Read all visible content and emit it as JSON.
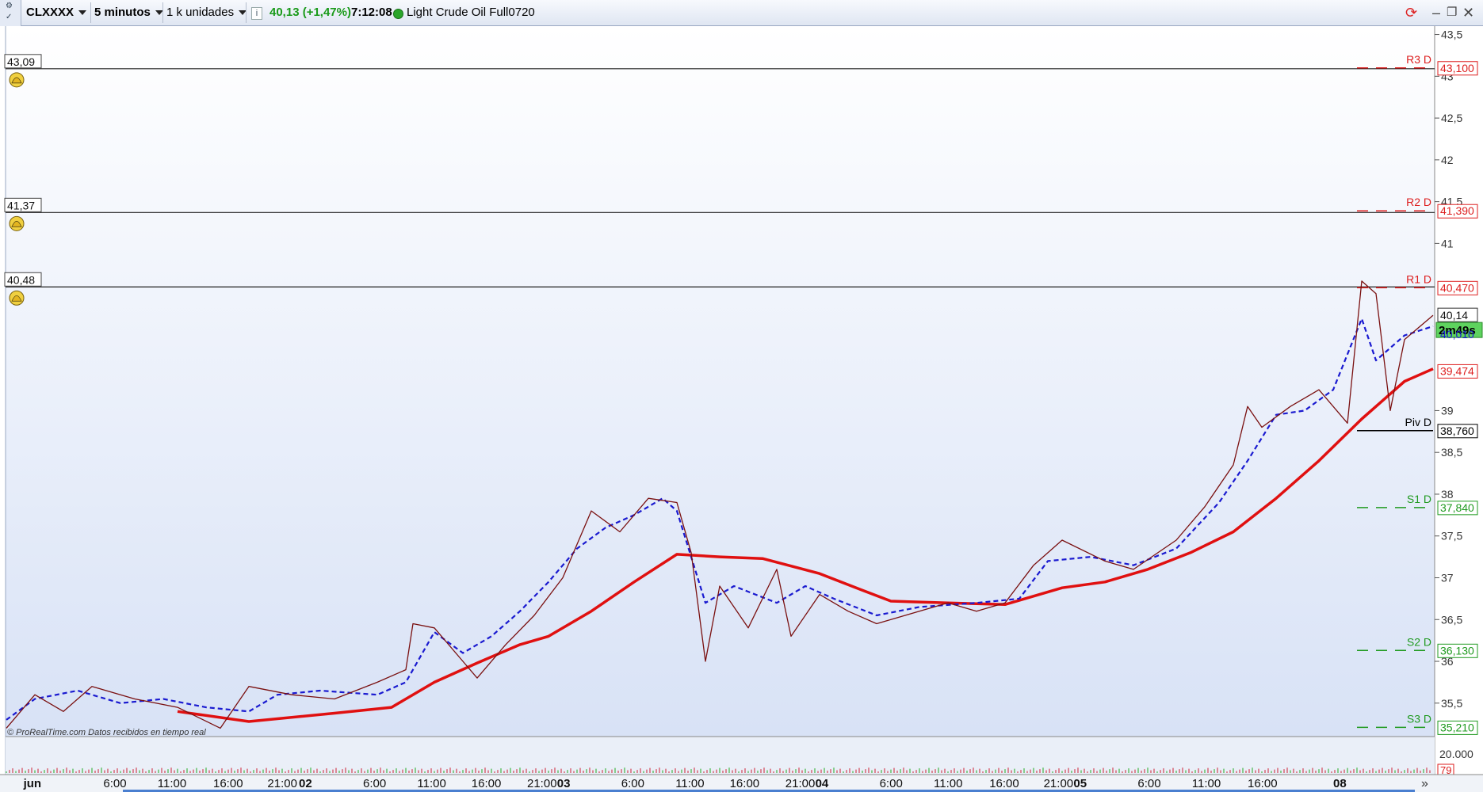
{
  "toolbar": {
    "symbol": "CLXXXX",
    "interval": "5 minutos",
    "units": "1 k unidades",
    "info_icon": "i",
    "price_change": "40,13 (+1,47%)",
    "time": "7:12:08",
    "instrument": "Light Crude Oil Full0720"
  },
  "price_axis": {
    "ticks": [
      {
        "v": 43.5,
        "label": "43,5"
      },
      {
        "v": 43,
        "label": "43"
      },
      {
        "v": 42.5,
        "label": "42,5"
      },
      {
        "v": 42,
        "label": "42"
      },
      {
        "v": 41.5,
        "label": "41,5"
      },
      {
        "v": 41,
        "label": "41"
      },
      {
        "v": 39,
        "label": "39"
      },
      {
        "v": 38.5,
        "label": "38,5"
      },
      {
        "v": 38,
        "label": "38"
      },
      {
        "v": 37.5,
        "label": "37,5"
      },
      {
        "v": 37,
        "label": "37"
      },
      {
        "v": 36.5,
        "label": "36,5"
      },
      {
        "v": 36,
        "label": "36"
      },
      {
        "v": 35.5,
        "label": "35,5"
      }
    ],
    "current_price": "40,14",
    "countdown": "2m49s",
    "ma_value": "40,010",
    "ma200_value": "39,474"
  },
  "alerts": [
    {
      "value": 43.09,
      "label": "43,09"
    },
    {
      "value": 41.37,
      "label": "41,37"
    },
    {
      "value": 40.48,
      "label": "40,48"
    }
  ],
  "pivots": [
    {
      "name": "R3 D",
      "value": 43.1,
      "label": "43,100",
      "color": "#dd1e1e"
    },
    {
      "name": "R2 D",
      "value": 41.39,
      "label": "41,390",
      "color": "#dd1e1e"
    },
    {
      "name": "R1 D",
      "value": 40.47,
      "label": "40,470",
      "color": "#dd1e1e"
    },
    {
      "name": "Piv D",
      "value": 38.76,
      "label": "38,760",
      "color": "#000000"
    },
    {
      "name": "S1 D",
      "value": 37.84,
      "label": "37,840",
      "color": "#1f9a1f"
    },
    {
      "name": "S2 D",
      "value": 36.13,
      "label": "36,130",
      "color": "#1f9a1f"
    },
    {
      "name": "S3 D",
      "value": 35.21,
      "label": "35,210",
      "color": "#1f9a1f"
    }
  ],
  "watermark": "© ProRealTime.com  Datos recibidos en tiempo real",
  "volume_panel": {
    "scale_label": "20.000",
    "value_label": "79"
  },
  "time_axis": {
    "labels": [
      {
        "label": "jun",
        "bold": true,
        "t": 0.012
      },
      {
        "label": "6:00",
        "bold": false,
        "t": 0.068
      },
      {
        "label": "11:00",
        "bold": false,
        "t": 0.106
      },
      {
        "label": "16:00",
        "bold": false,
        "t": 0.145
      },
      {
        "label": "21:00",
        "bold": false,
        "t": 0.183
      },
      {
        "label": "02",
        "bold": true,
        "t": 0.205
      },
      {
        "label": "6:00",
        "bold": false,
        "t": 0.25
      },
      {
        "label": "11:00",
        "bold": false,
        "t": 0.288
      },
      {
        "label": "16:00",
        "bold": false,
        "t": 0.326
      },
      {
        "label": "21:00",
        "bold": false,
        "t": 0.365
      },
      {
        "label": "03",
        "bold": true,
        "t": 0.386
      },
      {
        "label": "6:00",
        "bold": false,
        "t": 0.431
      },
      {
        "label": "11:00",
        "bold": false,
        "t": 0.469
      },
      {
        "label": "16:00",
        "bold": false,
        "t": 0.507
      },
      {
        "label": "21:00",
        "bold": false,
        "t": 0.546
      },
      {
        "label": "04",
        "bold": true,
        "t": 0.567
      },
      {
        "label": "6:00",
        "bold": false,
        "t": 0.612
      },
      {
        "label": "11:00",
        "bold": false,
        "t": 0.65
      },
      {
        "label": "16:00",
        "bold": false,
        "t": 0.689
      },
      {
        "label": "21:00",
        "bold": false,
        "t": 0.727
      },
      {
        "label": "05",
        "bold": true,
        "t": 0.748
      },
      {
        "label": "6:00",
        "bold": false,
        "t": 0.793
      },
      {
        "label": "11:00",
        "bold": false,
        "t": 0.831
      },
      {
        "label": "16:00",
        "bold": false,
        "t": 0.87
      },
      {
        "label": "08",
        "bold": true,
        "t": 0.93
      }
    ],
    "scroll_arrow": "»"
  },
  "chart_data": {
    "type": "line",
    "ylim": [
      35.1,
      43.6
    ],
    "series": [
      {
        "color": "#e01010",
        "points": [
          [
            0.12,
            35.4
          ],
          [
            0.17,
            35.28
          ],
          [
            0.23,
            35.38
          ],
          [
            0.27,
            35.45
          ],
          [
            0.3,
            35.75
          ],
          [
            0.33,
            35.98
          ],
          [
            0.36,
            36.2
          ],
          [
            0.38,
            36.3
          ],
          [
            0.41,
            36.6
          ],
          [
            0.44,
            36.95
          ],
          [
            0.47,
            37.28
          ],
          [
            0.5,
            37.25
          ],
          [
            0.53,
            37.23
          ],
          [
            0.57,
            37.05
          ],
          [
            0.6,
            36.85
          ],
          [
            0.62,
            36.72
          ],
          [
            0.66,
            36.7
          ],
          [
            0.7,
            36.68
          ],
          [
            0.74,
            36.88
          ],
          [
            0.77,
            36.95
          ],
          [
            0.8,
            37.1
          ],
          [
            0.83,
            37.3
          ],
          [
            0.86,
            37.55
          ],
          [
            0.89,
            37.95
          ],
          [
            0.92,
            38.4
          ],
          [
            0.95,
            38.9
          ],
          [
            0.98,
            39.35
          ],
          [
            1.0,
            39.5
          ]
        ]
      },
      {
        "color": "#1a1ad0",
        "points": [
          [
            0.0,
            35.3
          ],
          [
            0.02,
            35.55
          ],
          [
            0.05,
            35.65
          ],
          [
            0.08,
            35.5
          ],
          [
            0.11,
            35.55
          ],
          [
            0.14,
            35.45
          ],
          [
            0.17,
            35.4
          ],
          [
            0.19,
            35.6
          ],
          [
            0.22,
            35.65
          ],
          [
            0.26,
            35.6
          ],
          [
            0.28,
            35.75
          ],
          [
            0.3,
            36.35
          ],
          [
            0.32,
            36.1
          ],
          [
            0.34,
            36.3
          ],
          [
            0.36,
            36.6
          ],
          [
            0.38,
            36.95
          ],
          [
            0.4,
            37.35
          ],
          [
            0.42,
            37.6
          ],
          [
            0.44,
            37.75
          ],
          [
            0.46,
            37.95
          ],
          [
            0.47,
            37.8
          ],
          [
            0.49,
            36.7
          ],
          [
            0.51,
            36.9
          ],
          [
            0.54,
            36.7
          ],
          [
            0.56,
            36.9
          ],
          [
            0.58,
            36.75
          ],
          [
            0.61,
            36.55
          ],
          [
            0.64,
            36.65
          ],
          [
            0.68,
            36.7
          ],
          [
            0.71,
            36.75
          ],
          [
            0.73,
            37.2
          ],
          [
            0.76,
            37.25
          ],
          [
            0.79,
            37.15
          ],
          [
            0.82,
            37.35
          ],
          [
            0.85,
            37.9
          ],
          [
            0.87,
            38.4
          ],
          [
            0.89,
            38.95
          ],
          [
            0.91,
            39.0
          ],
          [
            0.93,
            39.25
          ],
          [
            0.95,
            40.1
          ],
          [
            0.96,
            39.6
          ],
          [
            0.98,
            39.9
          ],
          [
            1.0,
            40.01
          ]
        ]
      },
      {
        "color": "#7a1010",
        "points": [
          [
            0.0,
            35.2
          ],
          [
            0.02,
            35.6
          ],
          [
            0.04,
            35.4
          ],
          [
            0.06,
            35.7
          ],
          [
            0.09,
            35.55
          ],
          [
            0.12,
            35.45
          ],
          [
            0.15,
            35.2
          ],
          [
            0.17,
            35.7
          ],
          [
            0.2,
            35.6
          ],
          [
            0.23,
            35.55
          ],
          [
            0.26,
            35.75
          ],
          [
            0.28,
            35.9
          ],
          [
            0.285,
            36.45
          ],
          [
            0.3,
            36.4
          ],
          [
            0.32,
            36.0
          ],
          [
            0.33,
            35.8
          ],
          [
            0.35,
            36.2
          ],
          [
            0.37,
            36.55
          ],
          [
            0.39,
            37.0
          ],
          [
            0.41,
            37.8
          ],
          [
            0.43,
            37.55
          ],
          [
            0.45,
            37.95
          ],
          [
            0.47,
            37.9
          ],
          [
            0.48,
            37.3
          ],
          [
            0.49,
            36.0
          ],
          [
            0.5,
            36.9
          ],
          [
            0.52,
            36.4
          ],
          [
            0.54,
            37.1
          ],
          [
            0.55,
            36.3
          ],
          [
            0.57,
            36.8
          ],
          [
            0.59,
            36.6
          ],
          [
            0.61,
            36.45
          ],
          [
            0.63,
            36.55
          ],
          [
            0.66,
            36.7
          ],
          [
            0.68,
            36.6
          ],
          [
            0.7,
            36.7
          ],
          [
            0.72,
            37.15
          ],
          [
            0.74,
            37.45
          ],
          [
            0.77,
            37.2
          ],
          [
            0.79,
            37.1
          ],
          [
            0.82,
            37.45
          ],
          [
            0.84,
            37.85
          ],
          [
            0.86,
            38.35
          ],
          [
            0.87,
            39.05
          ],
          [
            0.88,
            38.8
          ],
          [
            0.9,
            39.05
          ],
          [
            0.92,
            39.25
          ],
          [
            0.94,
            38.85
          ],
          [
            0.95,
            40.55
          ],
          [
            0.96,
            40.4
          ],
          [
            0.97,
            39.0
          ],
          [
            0.98,
            39.85
          ],
          [
            1.0,
            40.14
          ]
        ]
      }
    ],
    "volume_level": 0.12
  }
}
